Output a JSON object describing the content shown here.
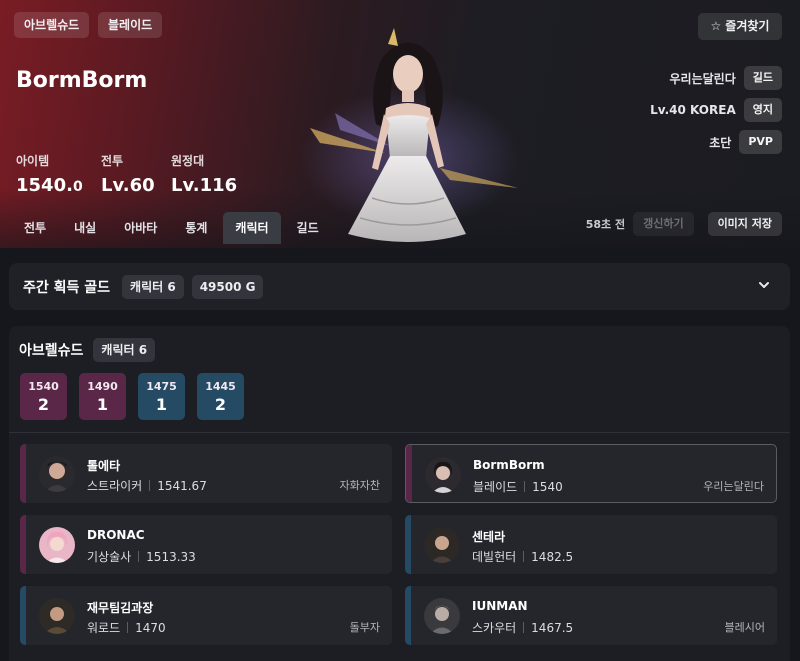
{
  "header": {
    "tags": [
      "아브렐슈드",
      "블레이드"
    ],
    "favorite_label": "즐겨찾기",
    "character_name": "BormBorm",
    "stats": [
      {
        "label": "아이템",
        "value": "1540.",
        "value_small": "0"
      },
      {
        "label": "전투",
        "value": "Lv.60",
        "value_small": ""
      },
      {
        "label": "원정대",
        "value": "Lv.116",
        "value_small": ""
      }
    ],
    "info": [
      {
        "text": "우리는달린다",
        "pill": "길드"
      },
      {
        "text": "Lv.40 KOREA",
        "pill": "영지"
      },
      {
        "text": "초단",
        "pill": "PVP"
      }
    ],
    "tabs": [
      "전투",
      "내실",
      "아바타",
      "통계",
      "캐릭터",
      "길드"
    ],
    "active_tab": "캐릭터",
    "refresh_ago": "58초 전",
    "refresh_label": "갱신하기",
    "save_image_label": "이미지 저장"
  },
  "gold": {
    "title": "주간 획득 골드",
    "character_count": "캐릭터 6",
    "amount": "49500 G"
  },
  "server": {
    "name": "아브렐슈드",
    "character_count": "캐릭터 6",
    "levels": [
      {
        "level": "1540",
        "count": "2",
        "color": "#5a2748"
      },
      {
        "level": "1490",
        "count": "1",
        "color": "#5a2748"
      },
      {
        "level": "1475",
        "count": "1",
        "color": "#254a63"
      },
      {
        "level": "1445",
        "count": "2",
        "color": "#254a63"
      }
    ],
    "characters": [
      {
        "name": "톨에타",
        "class": "스트라이커",
        "level": "1541.67",
        "guild": "자화자찬",
        "stripe": "#5a2748"
      },
      {
        "name": "BormBorm",
        "class": "블레이드",
        "level": "1540",
        "guild": "우리는달린다",
        "stripe": "#5a2748"
      },
      {
        "name": "DRONAC",
        "class": "기상술사",
        "level": "1513.33",
        "guild": "",
        "stripe": "#5a2748"
      },
      {
        "name": "센테라",
        "class": "데빌헌터",
        "level": "1482.5",
        "guild": "",
        "stripe": "#254a63"
      },
      {
        "name": "재무팀김과장",
        "class": "워로드",
        "level": "1470",
        "guild": "돌부자",
        "stripe": "#254a63"
      },
      {
        "name": "IUNMAN",
        "class": "스카우터",
        "level": "1467.5",
        "guild": "블레시어",
        "stripe": "#254a63"
      }
    ]
  }
}
